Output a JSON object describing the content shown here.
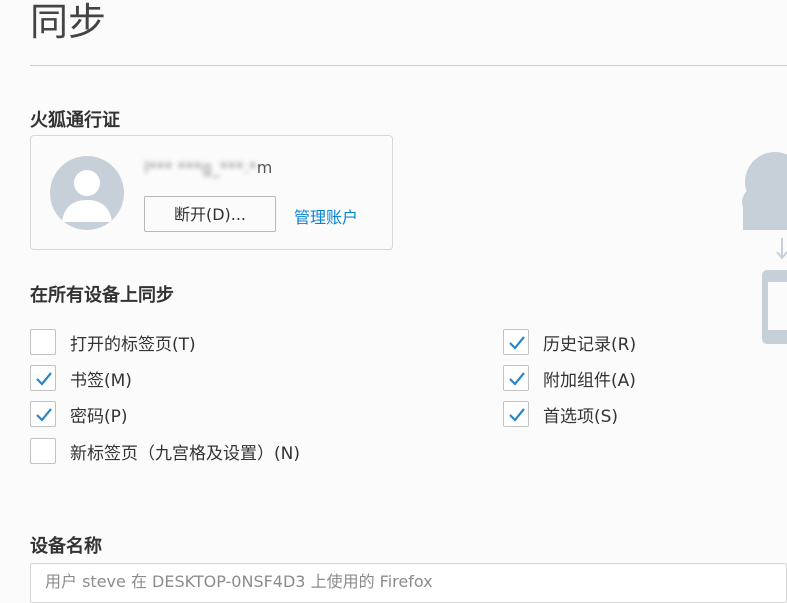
{
  "page": {
    "title": "同步"
  },
  "account": {
    "section_title": "火狐通行证",
    "email_masked": "l*** ***g_***.*",
    "email_suffix": "m",
    "disconnect_label": "断开(D)...",
    "manage_label": "管理账户"
  },
  "sync": {
    "section_title": "在所有设备上同步",
    "items": [
      {
        "label": "打开的标签页(T)",
        "checked": false
      },
      {
        "label": "书签(M)",
        "checked": true
      },
      {
        "label": "密码(P)",
        "checked": true
      },
      {
        "label": "新标签页（九宫格及设置）(N)",
        "checked": false
      },
      {
        "label": "历史记录(R)",
        "checked": true
      },
      {
        "label": "附加组件(A)",
        "checked": true
      },
      {
        "label": "首选项(S)",
        "checked": true
      }
    ]
  },
  "device": {
    "section_title": "设备名称",
    "placeholder": "用户 steve 在 DESKTOP-0NSF4D3 上使用的 Firefox"
  },
  "colors": {
    "accent": "#0a84d0",
    "check": "#2b86c7",
    "avatar_bg": "#c7d0d9",
    "illustration": "#c7d0d9"
  },
  "icons": {
    "avatar": "user-silhouette-icon",
    "check": "checkmark-icon",
    "sync": "cloud-to-device-icon"
  }
}
